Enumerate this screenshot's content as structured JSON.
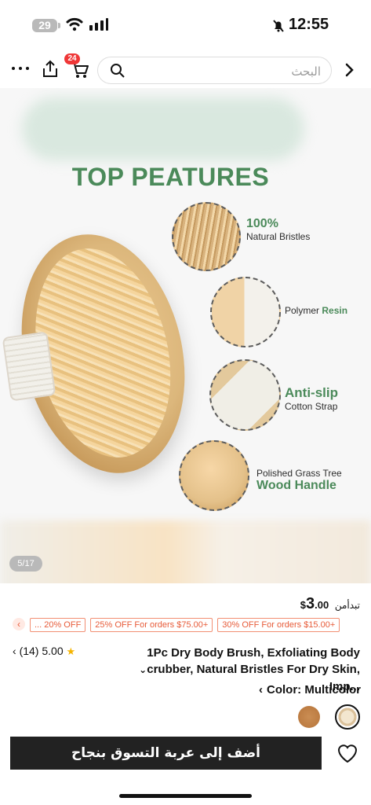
{
  "status": {
    "battery": "29",
    "time": "12:55"
  },
  "search": {
    "placeholder": "البحث"
  },
  "cart": {
    "count": "24"
  },
  "gallery": {
    "headline": "TOP PEATURES",
    "features": [
      {
        "top": "100%",
        "bottom": "Natural Bristles"
      },
      {
        "top": "Polymer",
        "bottom": "Resin"
      },
      {
        "top": "Anti-slip",
        "bottom": "Cotton Strap"
      },
      {
        "top": "Polished Grass Tree",
        "bottom": "Wood Handle"
      }
    ],
    "counter": "5/17"
  },
  "product": {
    "price_prefix": "تبدأمن",
    "price_symbol": "$",
    "price_major": "3",
    "price_minor": ".00",
    "discounts": [
      "... 20% OFF",
      "25% OFF For orders $75.00+",
      "30% OFF For orders $15.00+"
    ],
    "rating": "5.00",
    "reviews": "(14)",
    "title_line1": "1Pc Dry Body Brush, Exfoliating Body",
    "title_line2": "crubber, Natural Bristles For Dry Skin, Imp...",
    "color_label": "Color: Multicolor"
  },
  "footer": {
    "add_to_cart": "أضف إلى عربة التسوق بنجاح"
  },
  "colors": {
    "accent_green": "#4b8a5a",
    "discount": "#e75b39",
    "cart_badge": "#ef3737"
  }
}
